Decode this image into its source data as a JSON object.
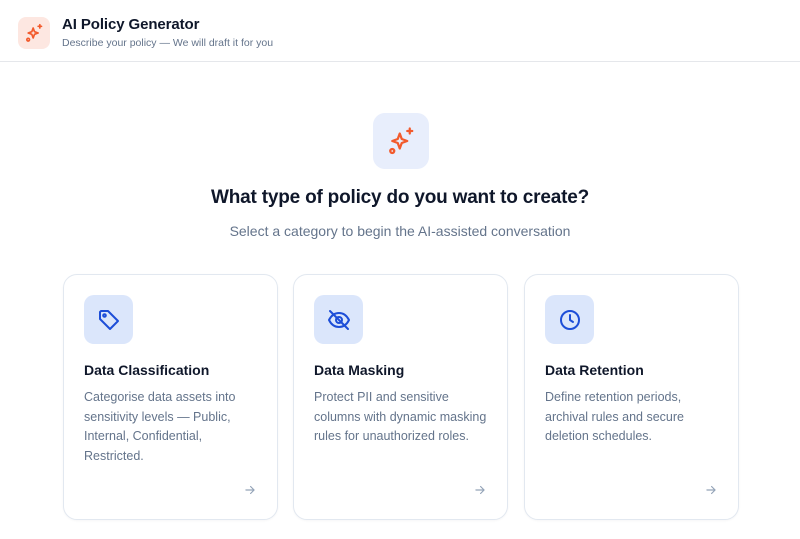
{
  "header": {
    "logo_icon": "sparkles-icon",
    "title": "AI Policy Generator",
    "subtitle": "Describe your policy — We will draft it for you"
  },
  "hero": {
    "icon": "sparkles-icon",
    "heading": "What type of policy do you want to create?",
    "subheading": "Select a category to begin the AI-assisted conversation"
  },
  "cards": [
    {
      "icon": "tag-icon",
      "title": "Data Classification",
      "description": "Categorise data assets into sensitivity levels — Public, Internal, Confidential, Restricted."
    },
    {
      "icon": "eye-off-icon",
      "title": "Data Masking",
      "description": "Protect PII and sensitive columns with dynamic masking rules for unauthorized roles."
    },
    {
      "icon": "clock-icon",
      "title": "Data Retention",
      "description": "Define retention periods, archival rules and secure deletion schedules."
    }
  ],
  "colors": {
    "accent": "#f25a2c",
    "icon_blue": "#1d4ed8",
    "icon_bg": "#dbe6fb",
    "logo_bg": "#fde7e1"
  }
}
